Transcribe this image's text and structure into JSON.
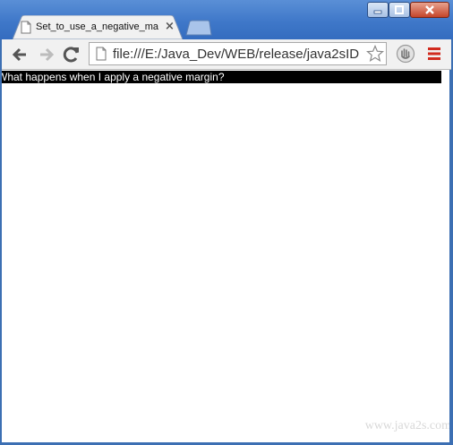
{
  "tab": {
    "title": "Set_to_use_a_negative_ma",
    "close": "×"
  },
  "omnibox": {
    "url": "file:///E:/Java_Dev/WEB/release/java2sID"
  },
  "page": {
    "text": "What happens when I apply a negative margin?"
  },
  "watermark": "www.java2s.com",
  "icons": [
    "minimize-icon",
    "maximize-icon",
    "close-icon",
    "page-icon",
    "back-arrow-icon",
    "forward-arrow-icon",
    "reload-icon",
    "star-icon",
    "extension-icon",
    "menu-icon"
  ]
}
